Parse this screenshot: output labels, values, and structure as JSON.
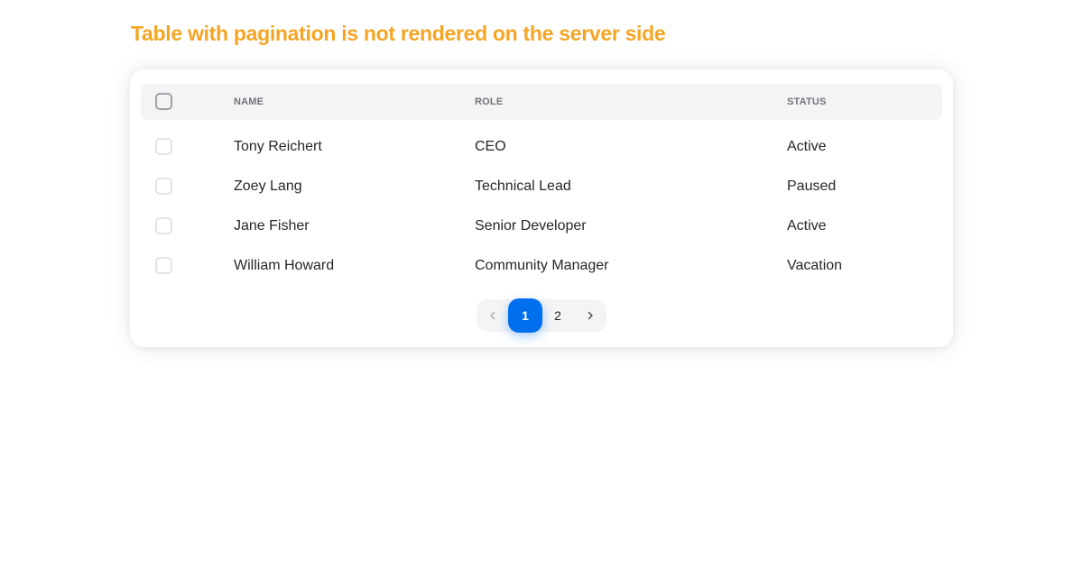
{
  "page": {
    "title": "Table with pagination is not rendered on the server side"
  },
  "table": {
    "columns": [
      "NAME",
      "ROLE",
      "STATUS"
    ],
    "rows": [
      {
        "name": "Tony Reichert",
        "role": "CEO",
        "status": "Active"
      },
      {
        "name": "Zoey Lang",
        "role": "Technical Lead",
        "status": "Paused"
      },
      {
        "name": "Jane Fisher",
        "role": "Senior Developer",
        "status": "Active"
      },
      {
        "name": "William Howard",
        "role": "Community Manager",
        "status": "Vacation"
      }
    ]
  },
  "pagination": {
    "pages": [
      "1",
      "2"
    ],
    "current": "1",
    "prev_icon": "chevron-left-icon",
    "next_icon": "chevron-right-icon"
  },
  "colors": {
    "title": "#f5a524",
    "accent": "#006fee"
  }
}
